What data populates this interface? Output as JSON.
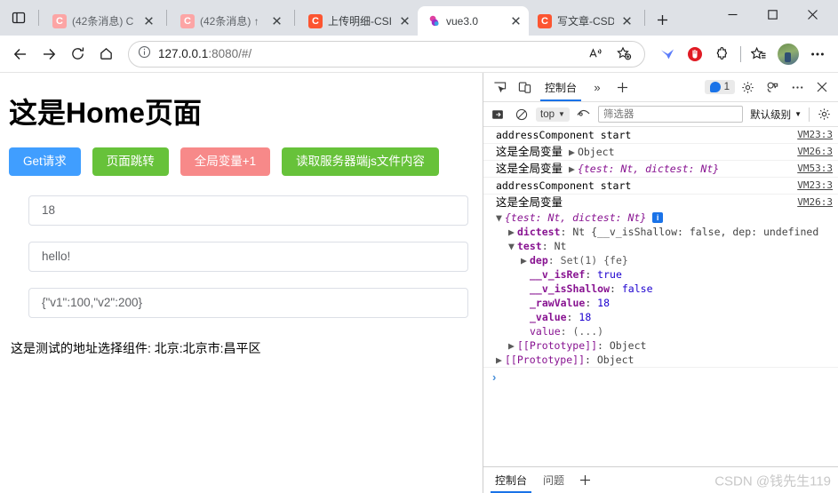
{
  "browser": {
    "tabs": [
      {
        "title": "(42条消息) C",
        "favicon": "csdn-icon",
        "active": false,
        "dim": true
      },
      {
        "title": "(42条消息) ↑",
        "favicon": "csdn-icon",
        "active": false,
        "dim": true
      },
      {
        "title": "上传明细-CSI",
        "favicon": "csdn-icon-strong",
        "active": false,
        "dim": false
      },
      {
        "title": "vue3.0",
        "favicon": "vue-icon",
        "active": true,
        "dim": false
      },
      {
        "title": "写文章-CSDN",
        "favicon": "csdn-icon-strong",
        "active": false,
        "dim": false
      }
    ],
    "new_tab_label": "+",
    "window_controls": {
      "minimize": "—",
      "maximize": "▢",
      "close": "✕"
    },
    "toolbar": {
      "back": "back-arrow",
      "forward": "forward-arrow",
      "reload": "reload-icon",
      "home": "home-icon",
      "url_host": "127.0.0.1",
      "url_rest": ":8080/#/",
      "read_aloud": "A-sound-icon",
      "add_favorite": "star-plus-icon",
      "collections": "collections-icon",
      "extensions": "extensions-icon",
      "favorites": "favorites-icon",
      "settings_more": "…"
    }
  },
  "page": {
    "title": "这是Home页面",
    "buttons": [
      {
        "label": "Get请求",
        "color": "#409eff"
      },
      {
        "label": "页面跳转",
        "color": "#67c23a"
      },
      {
        "label": "全局变量+1",
        "color": "#f78989"
      },
      {
        "label": "读取服务器端js文件内容",
        "color": "#67c23a"
      }
    ],
    "inputs": [
      {
        "value": "18",
        "placeholder": ""
      },
      {
        "value": "hello!",
        "placeholder": ""
      },
      {
        "value": "{\"v1\":100,\"v2\":200}",
        "placeholder": ""
      }
    ],
    "address_text": "这是测试的地址选择组件: 北京:北京市:昌平区"
  },
  "devtools": {
    "toolbar": {
      "inspect": "inspect-icon",
      "device": "device-toolbar-icon",
      "tabs": [
        {
          "label": "控制台",
          "active": true
        }
      ],
      "more_tabs": "»",
      "add_tab": "+",
      "issues_count": "1",
      "settings": "gear-icon",
      "customize": "dots-bubble-icon",
      "more": "…",
      "close": "✕"
    },
    "filterbar": {
      "clear": "clear-console-icon",
      "no_entry": "no-entry-icon",
      "context": "top",
      "eye": "live-expression-icon",
      "filter_placeholder": "筛选器",
      "filter_value": "",
      "level": "默认级别",
      "settings": "gear-icon"
    },
    "logs": [
      {
        "type": "plain",
        "msg": "addressComponent start",
        "source": "VM23:3"
      },
      {
        "type": "obj_collapsed",
        "cjk": "这是全局变量",
        "preview": "Object",
        "source": "VM26:3"
      },
      {
        "type": "obj_collapsed",
        "cjk": "这是全局变量",
        "preview": "{test: Nt, dictest: Nt}",
        "source": "VM53:3"
      },
      {
        "type": "plain",
        "msg": "addressComponent start",
        "source": "VM23:3"
      }
    ],
    "expanded": {
      "header_cjk": "这是全局变量",
      "header_source": "VM26:3",
      "rows": [
        {
          "indent": 0,
          "arrow": "▼",
          "text": "{test: Nt, dictest: Nt}",
          "style": "italic",
          "info": true
        },
        {
          "indent": 1,
          "arrow": "▶",
          "key": "dictest",
          "text": "Nt {__v_isShallow: false, dep: undefined"
        },
        {
          "indent": 1,
          "arrow": "▼",
          "key": "test",
          "text": "Nt"
        },
        {
          "indent": 2,
          "arrow": "▶",
          "key": "dep",
          "text": "Set(1) {fe}"
        },
        {
          "indent": 2,
          "arrow": "",
          "key": "__v_isRef",
          "text": "true",
          "valtype": "bool"
        },
        {
          "indent": 2,
          "arrow": "",
          "key": "__v_isShallow",
          "text": "false",
          "valtype": "bool"
        },
        {
          "indent": 2,
          "arrow": "",
          "key": "_rawValue",
          "text": "18",
          "valtype": "num"
        },
        {
          "indent": 2,
          "arrow": "",
          "key": "_value",
          "text": "18",
          "valtype": "num"
        },
        {
          "indent": 2,
          "arrow": "",
          "key_plain": "value",
          "text": "(...)",
          "valtype": "dim"
        },
        {
          "indent": 1,
          "arrow": "▶",
          "key_plain": "[[Prototype]]",
          "text": "Object"
        },
        {
          "indent": 0,
          "arrow": "▶",
          "key_plain": "[[Prototype]]",
          "text": "Object"
        }
      ]
    },
    "prompt": "›",
    "drawer": {
      "tabs": [
        {
          "label": "控制台",
          "active": true
        },
        {
          "label": "问题",
          "active": false
        }
      ],
      "add": "+",
      "watermark": "CSDN @钱先生119"
    }
  }
}
